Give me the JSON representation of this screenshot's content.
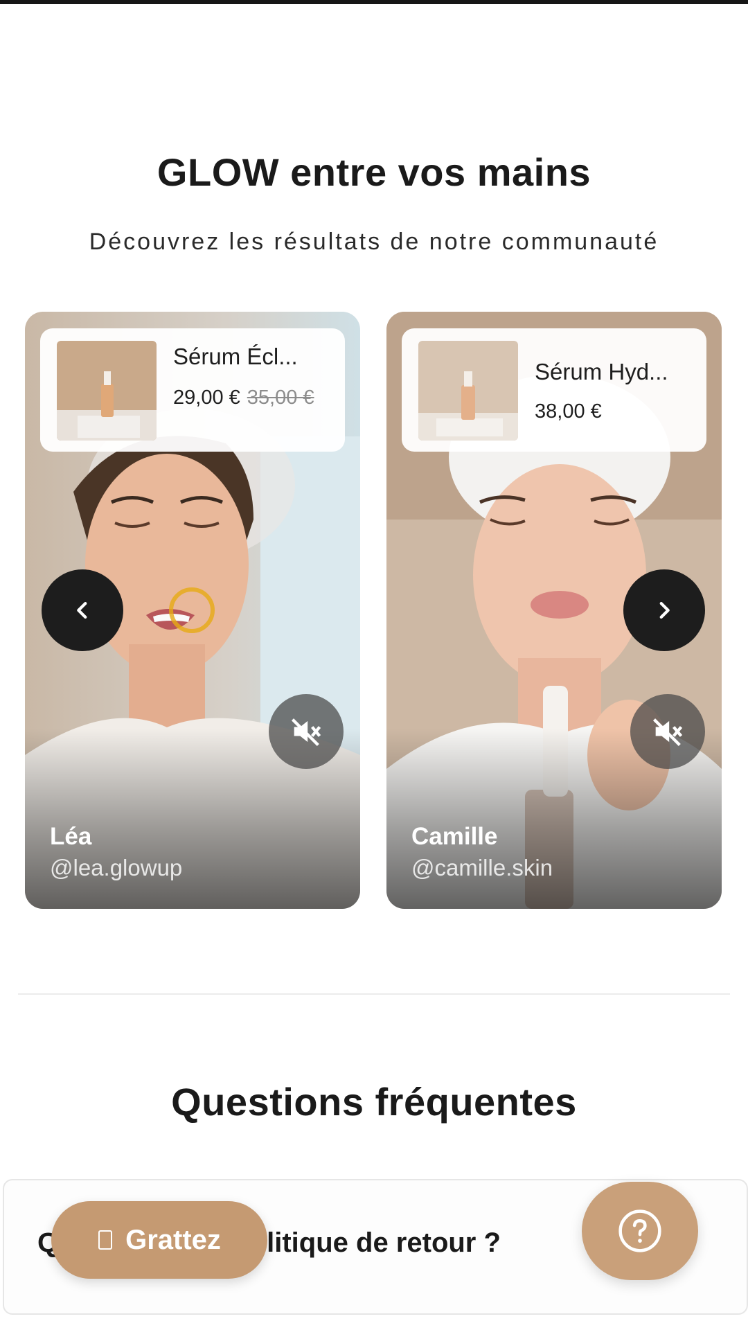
{
  "ugc_section": {
    "title": "GLOW entre vos mains",
    "subtitle": "Découvrez les résultats de notre communauté",
    "cards": [
      {
        "product_name": "Sérum Écl...",
        "price": "29,00 €",
        "old_price": "35,00 €",
        "creator_name": "Léa",
        "creator_handle": "@lea.glowup"
      },
      {
        "product_name": "Sérum Hyd...",
        "price": "38,00 €",
        "creator_name": "Camille",
        "creator_handle": "@camille.skin"
      }
    ],
    "prev_icon": "chevron-left-icon",
    "next_icon": "chevron-right-icon",
    "mute_icon": "volume-muted-icon"
  },
  "faq": {
    "title": "Questions fréquentes",
    "item_visible_start": "Q",
    "item_visible_end": "litique de retour ?"
  },
  "floating": {
    "grattez_label": "Grattez",
    "grattez_icon": "card-icon",
    "help_icon": "question-circle-icon"
  },
  "colors": {
    "accent": "#c59a72",
    "dark_button": "#1d1d1d",
    "text": "#1a1a1a"
  }
}
